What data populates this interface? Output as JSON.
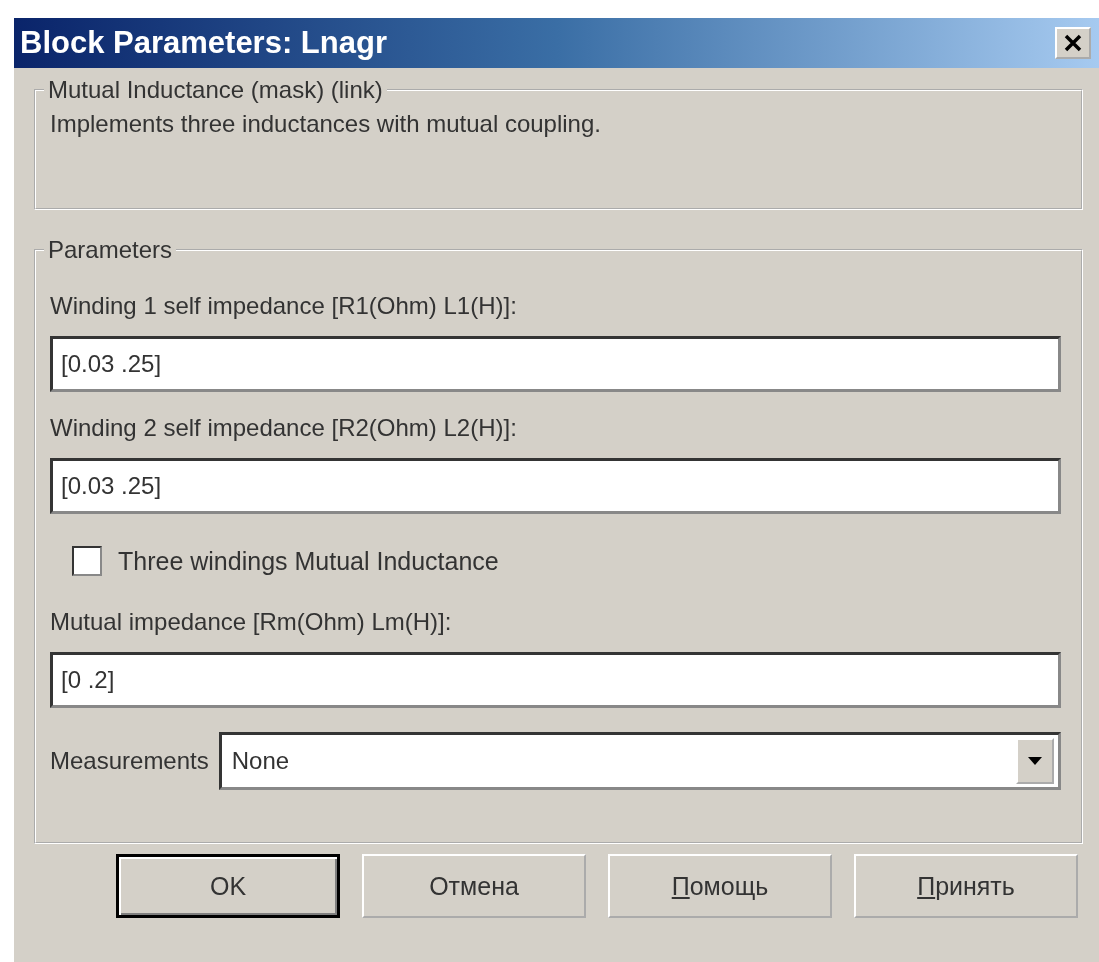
{
  "window": {
    "title": "Block Parameters: Lnagr"
  },
  "description_group": {
    "title": "Mutual Inductance (mask) (link)",
    "text": "Implements three inductances with mutual coupling."
  },
  "parameters_group": {
    "title": "Parameters",
    "items": [
      {
        "kind": "field",
        "label": "Winding 1 self impedance [R1(Ohm) L1(H)]:",
        "value": "[0.03 .25]"
      },
      {
        "kind": "field",
        "label": "Winding 2 self impedance [R2(Ohm) L2(H)]:",
        "value": "[0.03 .25]"
      },
      {
        "kind": "checkbox",
        "label": "Three windings Mutual Inductance",
        "checked": false
      },
      {
        "kind": "field",
        "label": "Mutual impedance [Rm(Ohm) Lm(H)]:",
        "value": "[0 .2]"
      },
      {
        "kind": "dropdown",
        "label": "Measurements",
        "value": "None"
      }
    ]
  },
  "buttons": [
    {
      "label": "OK",
      "default": true,
      "mnemonic": false
    },
    {
      "label": "Отмена",
      "default": false,
      "mnemonic": false
    },
    {
      "label": "Помощь",
      "default": false,
      "mnemonic": true
    },
    {
      "label": "Принять",
      "default": false,
      "mnemonic": true
    }
  ]
}
